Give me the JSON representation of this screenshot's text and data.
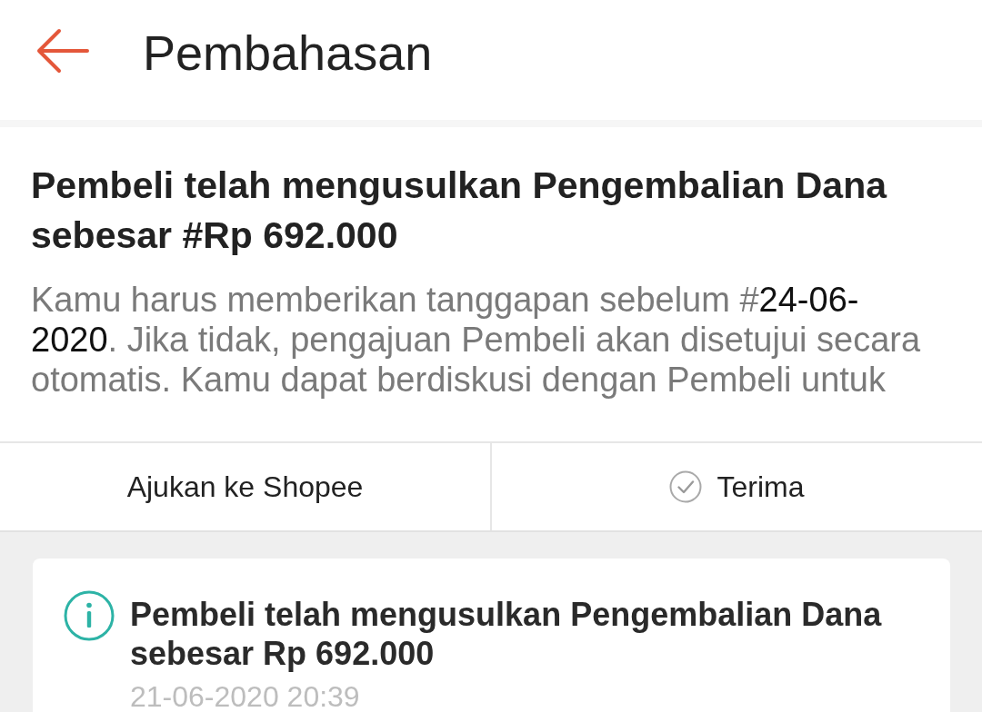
{
  "header": {
    "title": "Pembahasan"
  },
  "proposal": {
    "title": "Pembeli telah mengusulkan Pengembalian Dana sebesar #Rp 692.000",
    "description": [
      {
        "text": "Kamu harus memberikan tanggapan sebelum #",
        "emphasis": false
      },
      {
        "text": "24-06-2020",
        "emphasis": true
      },
      {
        "text": ". Jika tidak, pengajuan Pembeli akan disetujui secara otomatis. Kamu dapat berdiskusi dengan Pembeli untuk",
        "emphasis": false
      }
    ]
  },
  "actions": [
    {
      "kind": "text",
      "label": "Ajukan ke Shopee"
    },
    {
      "kind": "check",
      "label": "Terima"
    }
  ],
  "history": [
    {
      "kind": "info",
      "title": "Pembeli telah mengusulkan Pengembalian Dana sebesar Rp 692.000",
      "time": "21-06-2020 20:39"
    }
  ]
}
